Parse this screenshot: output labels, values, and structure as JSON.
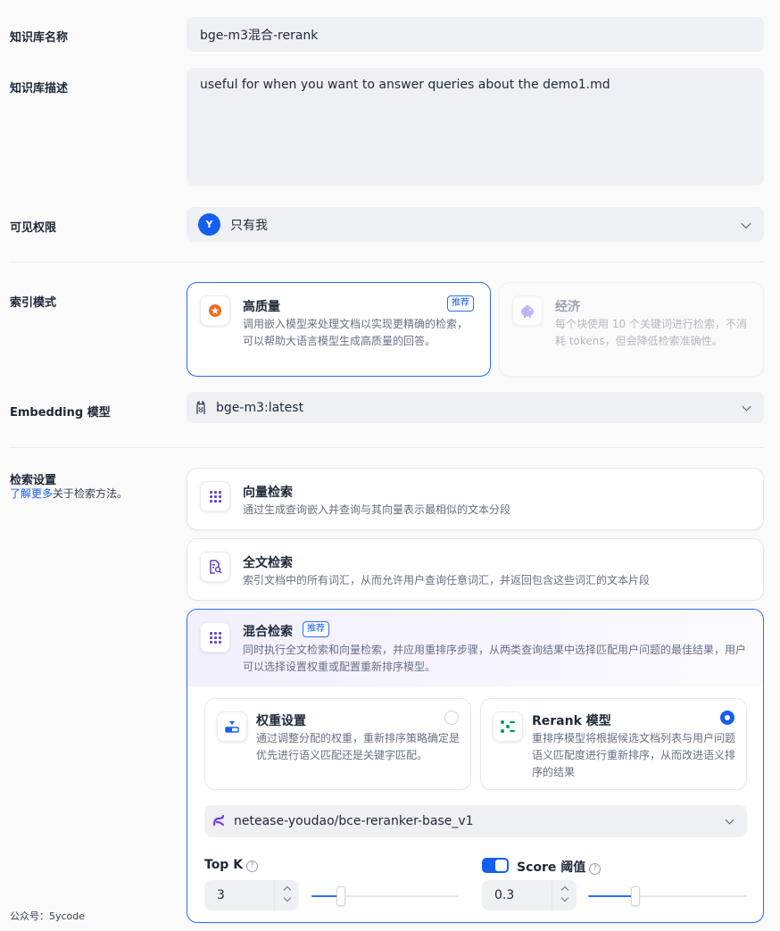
{
  "name": {
    "label": "知识库名称",
    "value": "bge-m3混合-rerank"
  },
  "description": {
    "label": "知识库描述",
    "value": "useful for when you want to answer queries about the demo1.md"
  },
  "permission": {
    "label": "可见权限",
    "avatar": "Y",
    "value": "只有我"
  },
  "index_mode": {
    "label": "索引模式",
    "high_quality": {
      "title": "高质量",
      "badge": "推荐",
      "desc": "调用嵌入模型来处理文档以实现更精确的检索，可以帮助大语言模型生成高质量的回答。"
    },
    "economy": {
      "title": "经济",
      "desc": "每个块使用 10 个关键词进行检索，不消耗 tokens，但会降低检索准确性。"
    }
  },
  "embedding": {
    "label": "Embedding 模型",
    "value": "bge-m3:latest"
  },
  "retrieval": {
    "label": "检索设置",
    "learn_more": "了解更多",
    "learn_suffix": "关于检索方法。",
    "vector": {
      "title": "向量检索",
      "desc": "通过生成查询嵌入并查询与其向量表示最相似的文本分段"
    },
    "fulltext": {
      "title": "全文检索",
      "desc": "索引文档中的所有词汇，从而允许用户查询任意词汇，并返回包含这些词汇的文本片段"
    },
    "hybrid": {
      "title": "混合检索",
      "badge": "推荐",
      "desc": "同时执行全文检索和向量检索，并应用重排序步骤，从两类查询结果中选择匹配用户问题的最佳结果，用户可以选择设置权重或配置重新排序模型。",
      "weight": {
        "title": "权重设置",
        "desc": "通过调整分配的权重，重新排序策略确定是优先进行语义匹配还是关键字匹配。",
        "selected": false
      },
      "rerank": {
        "title": "Rerank 模型",
        "desc": "重排序模型将根据候选文档列表与用户问题语义匹配度进行重新排序，从而改进语义排序的结果",
        "selected": true
      },
      "rerank_model": "netease-youdao/bce-reranker-base_v1",
      "top_k": {
        "label": "Top K",
        "value": "3",
        "help": "?",
        "level": 0.2
      },
      "score": {
        "label": "Score 阈值",
        "value": "0.3",
        "help": "?",
        "enabled": true,
        "level": 0.3
      }
    }
  },
  "watermark": "公众号：5ycode",
  "colors": {
    "accent": "#155eef",
    "orange": "#f26a1b",
    "purple": "#6941c6",
    "green": "#039855"
  }
}
